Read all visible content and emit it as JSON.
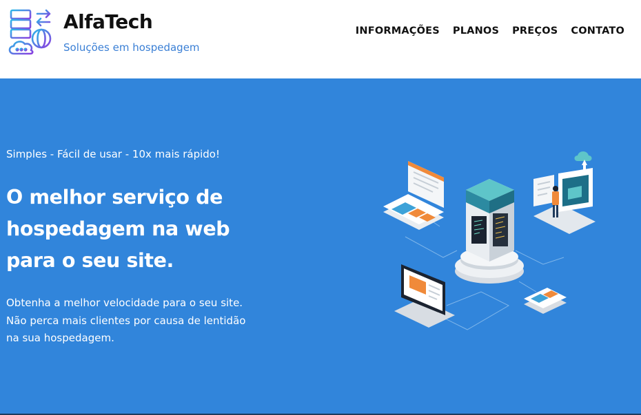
{
  "brand": {
    "name": "AlfaTech",
    "tagline": "Soluções em hospedagem",
    "logo_icon": "server-cloud-globe-icon"
  },
  "nav": {
    "items": [
      {
        "label": "INFORMAÇÕES"
      },
      {
        "label": "PLANOS"
      },
      {
        "label": "PREÇOS"
      },
      {
        "label": "CONTATO"
      }
    ]
  },
  "hero": {
    "kicker": "Simples - Fácil de usar - 10x mais rápido!",
    "title": "O melhor serviço de hospedagem na web para o seu site.",
    "description_lines": [
      "Obtenha a melhor velocidade para o seu site.",
      "Não perca mais clientes por causa de lentidão",
      "na sua hospedagem."
    ],
    "illustration": "isometric-hosting-server-illustration"
  },
  "colors": {
    "hero_background": "#3185db",
    "tagline": "#3a7fd5",
    "nav_text": "#111111",
    "hero_text": "#ffffff"
  }
}
